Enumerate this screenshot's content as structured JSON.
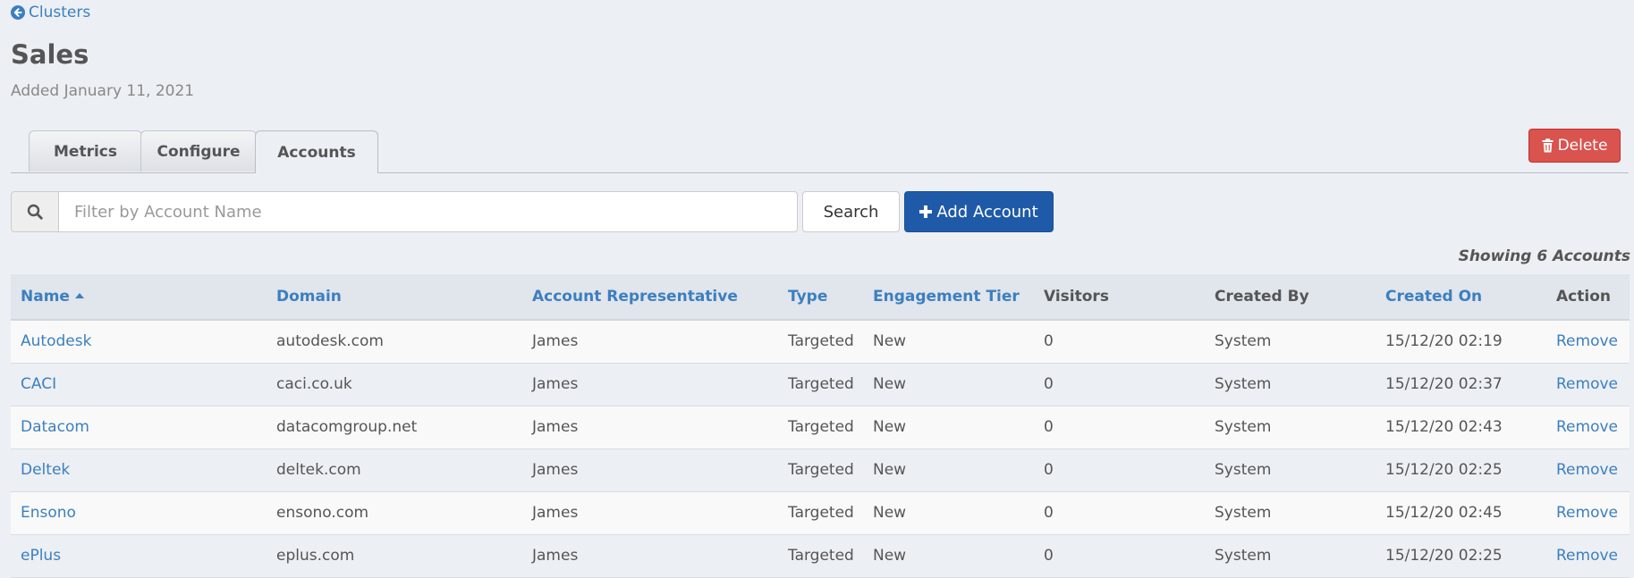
{
  "breadcrumb": {
    "back_label": "Clusters"
  },
  "page": {
    "title": "Sales",
    "subtitle": "Added January 11, 2021"
  },
  "tabs": [
    {
      "label": "Metrics",
      "active": false
    },
    {
      "label": "Configure",
      "active": false
    },
    {
      "label": "Accounts",
      "active": true
    }
  ],
  "actions": {
    "delete_label": "Delete"
  },
  "search": {
    "placeholder": "Filter by Account Name",
    "value": "",
    "button_label": "Search",
    "add_label": "Add Account"
  },
  "summary": {
    "showing": "Showing 6 Accounts"
  },
  "table": {
    "columns": [
      {
        "label": "Name",
        "sortable": true,
        "sorted": "asc"
      },
      {
        "label": "Domain",
        "sortable": true
      },
      {
        "label": "Account Representative",
        "sortable": true
      },
      {
        "label": "Type",
        "sortable": true
      },
      {
        "label": "Engagement Tier",
        "sortable": true
      },
      {
        "label": "Visitors",
        "sortable": false
      },
      {
        "label": "Created By",
        "sortable": false
      },
      {
        "label": "Created On",
        "sortable": true
      },
      {
        "label": "Action",
        "sortable": false
      }
    ],
    "rows": [
      {
        "name": "Autodesk",
        "domain": "autodesk.com",
        "rep": "James",
        "type": "Targeted",
        "tier": "New",
        "visitors": "0",
        "created_by": "System",
        "created_on": "15/12/20 02:19",
        "action": "Remove"
      },
      {
        "name": "CACI",
        "domain": "caci.co.uk",
        "rep": "James",
        "type": "Targeted",
        "tier": "New",
        "visitors": "0",
        "created_by": "System",
        "created_on": "15/12/20 02:37",
        "action": "Remove"
      },
      {
        "name": "Datacom",
        "domain": "datacomgroup.net",
        "rep": "James",
        "type": "Targeted",
        "tier": "New",
        "visitors": "0",
        "created_by": "System",
        "created_on": "15/12/20 02:43",
        "action": "Remove"
      },
      {
        "name": "Deltek",
        "domain": "deltek.com",
        "rep": "James",
        "type": "Targeted",
        "tier": "New",
        "visitors": "0",
        "created_by": "System",
        "created_on": "15/12/20 02:25",
        "action": "Remove"
      },
      {
        "name": "Ensono",
        "domain": "ensono.com",
        "rep": "James",
        "type": "Targeted",
        "tier": "New",
        "visitors": "0",
        "created_by": "System",
        "created_on": "15/12/20 02:45",
        "action": "Remove"
      },
      {
        "name": "ePlus",
        "domain": "eplus.com",
        "rep": "James",
        "type": "Targeted",
        "tier": "New",
        "visitors": "0",
        "created_by": "System",
        "created_on": "15/12/20 02:25",
        "action": "Remove"
      }
    ]
  },
  "icons": {
    "back": "arrow-circle-left-icon",
    "delete": "trash-icon",
    "search": "magnifier-icon",
    "add": "plus-icon"
  },
  "colors": {
    "link": "#3c7fc0",
    "primary": "#1f5aa8",
    "danger": "#d9534f",
    "background": "#eceff4"
  }
}
